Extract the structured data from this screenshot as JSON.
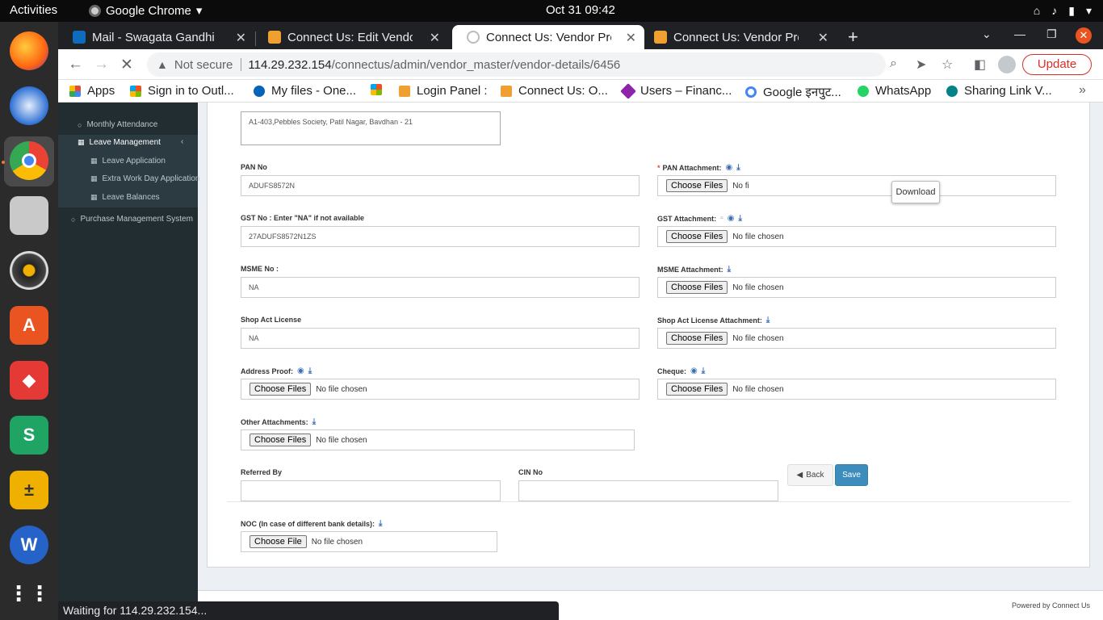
{
  "topbar": {
    "activities": "Activities",
    "app_name": "Google Chrome",
    "clock": "Oct 31  09:42"
  },
  "tabs": [
    {
      "title": "Mail - Swagata Gandhi - O",
      "favicon_color": "#0f6cbd"
    },
    {
      "title": "Connect Us: Edit Vendor M",
      "favicon_color": "#f0a030"
    },
    {
      "title": "Connect Us: Vendor Profil",
      "favicon_color": "#dddddd"
    },
    {
      "title": "Connect Us: Vendor Profil",
      "favicon_color": "#f0a030"
    }
  ],
  "omnibox": {
    "security": "Not secure",
    "host": "114.29.232.154",
    "path": "/connectus/admin/vendor_master/vendor-details/6456"
  },
  "toolbar": {
    "update_label": "Update"
  },
  "bookmarks": [
    {
      "label": "Apps",
      "color": "#e44b35"
    },
    {
      "label": "Sign in to Outl...",
      "color": "#f25022"
    },
    {
      "label": "My files - One...",
      "color": "#0364b8"
    },
    {
      "label": "",
      "color": "#7fba00"
    },
    {
      "label": "Login Panel :",
      "color": "#f0a030"
    },
    {
      "label": "Connect Us: O...",
      "color": "#f0a030"
    },
    {
      "label": "Users – Financ...",
      "color": "#8e24aa"
    },
    {
      "label": "Google इनपुट...",
      "color": "#4285f4"
    },
    {
      "label": "WhatsApp",
      "color": "#25d366"
    },
    {
      "label": "Sharing Link V...",
      "color": "#038387"
    }
  ],
  "sidebar": {
    "items": [
      {
        "label": "Monthly Attendance"
      },
      {
        "label": "Leave Management"
      },
      {
        "label": "Leave Application"
      },
      {
        "label": "Extra Work Day Application"
      },
      {
        "label": "Leave Balances"
      },
      {
        "label": "Purchase Management System"
      }
    ]
  },
  "form": {
    "address_value": "A1-403,Pebbles Society, Patil Nagar, Bavdhan - 21",
    "pan_label": "PAN No",
    "pan_value": "ADUFS8572N",
    "pan_attach_label": "PAN Attachment:",
    "gst_label": "GST No : Enter \"NA\" if not available",
    "gst_value": "27ADUFS8572N1ZS",
    "gst_attach_label": "GST Attachment:",
    "msme_label": "MSME No :",
    "msme_value": "NA",
    "msme_attach_label": "MSME Attachment:",
    "shop_label": "Shop Act License",
    "shop_value": "NA",
    "shop_attach_label": "Shop Act License Attachment:",
    "address_proof_label": "Address Proof:",
    "cheque_label": "Cheque:",
    "other_label": "Other Attachments:",
    "referred_label": "Referred By",
    "cin_label": "CIN No",
    "noc_label": "NOC (In case of different bank details):",
    "choose_files": "Choose Files",
    "choose_file": "Choose File",
    "no_file": "No file chosen",
    "pan_no_file_partial": "No fi",
    "tooltip": "Download",
    "back_label": "Back",
    "save_label": "Save"
  },
  "footer": {
    "powered": "Powered by Connect Us"
  },
  "status": "Waiting for 114.29.232.154..."
}
